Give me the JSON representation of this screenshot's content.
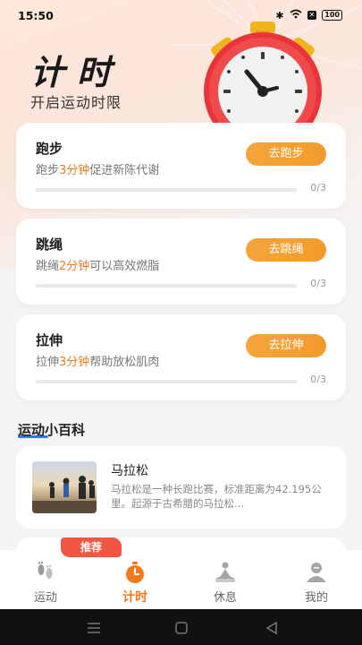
{
  "status": {
    "time": "15:50",
    "battery": "100"
  },
  "header": {
    "title": "计时",
    "subtitle": "开启运动时限"
  },
  "cards": [
    {
      "title": "跑步",
      "desc_pre": "跑步",
      "desc_hl": "3分钟",
      "desc_post": "促进新陈代谢",
      "button": "去跑步",
      "progress": "0/3"
    },
    {
      "title": "跳绳",
      "desc_pre": "跳绳",
      "desc_hl": "2分钟",
      "desc_post": "可以高效燃脂",
      "button": "去跳绳",
      "progress": "0/3"
    },
    {
      "title": "拉伸",
      "desc_pre": "拉伸",
      "desc_hl": "3分钟",
      "desc_post": "帮助放松肌肉",
      "button": "去拉伸",
      "progress": "0/3"
    }
  ],
  "section": {
    "title": "运动小百科"
  },
  "article": {
    "title": "马拉松",
    "desc": "马拉松是一种长跑比赛，标准距离为42.195公里。起源于古希腊的马拉松..."
  },
  "tag": "推荐",
  "tabs": [
    {
      "label": "运动",
      "icon": "footprints-icon"
    },
    {
      "label": "计时",
      "icon": "stopwatch-icon"
    },
    {
      "label": "休息",
      "icon": "meditation-icon"
    },
    {
      "label": "我的",
      "icon": "profile-icon"
    }
  ],
  "colors": {
    "accent": "#f07a1c",
    "button": "#f5a53a",
    "tag": "#f25744",
    "underline": "#2f7cf6"
  }
}
